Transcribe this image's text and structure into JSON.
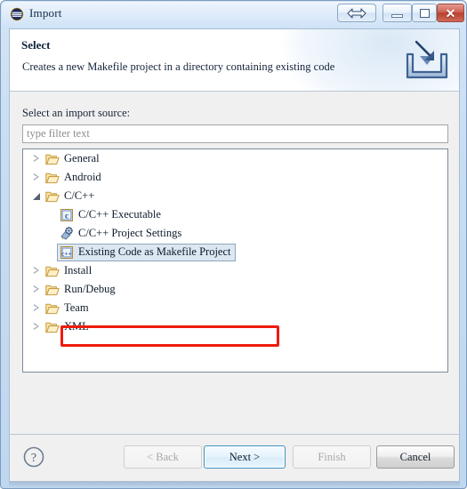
{
  "window": {
    "title": "Import",
    "icon": "eclipse-logo-icon",
    "controls": [
      {
        "name": "restore-extra-button",
        "icon": "left-right-arrows-icon",
        "label": ""
      },
      {
        "name": "minimize-button",
        "icon": "minimize-icon",
        "label": ""
      },
      {
        "name": "maximize-button",
        "icon": "maximize-icon",
        "label": ""
      },
      {
        "name": "close-button",
        "icon": "close-icon",
        "label": "✕"
      }
    ]
  },
  "header": {
    "title": "Select",
    "description": "Creates a new Makefile project in a directory containing existing code",
    "icon": "import-wizard-icon"
  },
  "main": {
    "source_label": "Select an import source:",
    "filter": {
      "value": "",
      "placeholder": "type filter text"
    },
    "tree": [
      {
        "label": "General",
        "level": 0,
        "icon": "folder-icon",
        "state": "collapsed",
        "selected": false
      },
      {
        "label": "Android",
        "level": 0,
        "icon": "folder-icon",
        "state": "collapsed",
        "selected": false
      },
      {
        "label": "C/C++",
        "level": 0,
        "icon": "folder-icon",
        "state": "expanded",
        "selected": false
      },
      {
        "label": "C/C++ Executable",
        "level": 1,
        "icon": "c-file-icon",
        "state": "leaf",
        "selected": false
      },
      {
        "label": "C/C++ Project Settings",
        "level": 1,
        "icon": "project-settings-icon",
        "state": "leaf",
        "selected": false
      },
      {
        "label": "Existing Code as Makefile Project",
        "level": 1,
        "icon": "cpp-file-icon",
        "state": "leaf",
        "selected": true
      },
      {
        "label": "Install",
        "level": 0,
        "icon": "folder-icon",
        "state": "collapsed",
        "selected": false
      },
      {
        "label": "Run/Debug",
        "level": 0,
        "icon": "folder-icon",
        "state": "collapsed",
        "selected": false
      },
      {
        "label": "Team",
        "level": 0,
        "icon": "folder-icon",
        "state": "collapsed",
        "selected": false
      },
      {
        "label": "XML",
        "level": 0,
        "icon": "folder-icon",
        "state": "collapsed",
        "selected": false
      }
    ],
    "annotation": {
      "target": "Existing Code as Makefile Project",
      "color": "#ef1a0d"
    }
  },
  "footer": {
    "help_icon": "help-question-icon",
    "buttons": [
      {
        "name": "back-button",
        "label": "< Back",
        "enabled": false,
        "default": false
      },
      {
        "name": "next-button",
        "label": "Next >",
        "enabled": true,
        "default": true
      },
      {
        "name": "finish-button",
        "label": "Finish",
        "enabled": false,
        "default": false
      },
      {
        "name": "cancel-button",
        "label": "Cancel",
        "enabled": true,
        "default": false
      }
    ]
  },
  "colors": {
    "accent": "#3c93c2",
    "annotation": "#ef1a0d",
    "selection": "#dce7f2",
    "titlebar": "#cfe2f6"
  }
}
